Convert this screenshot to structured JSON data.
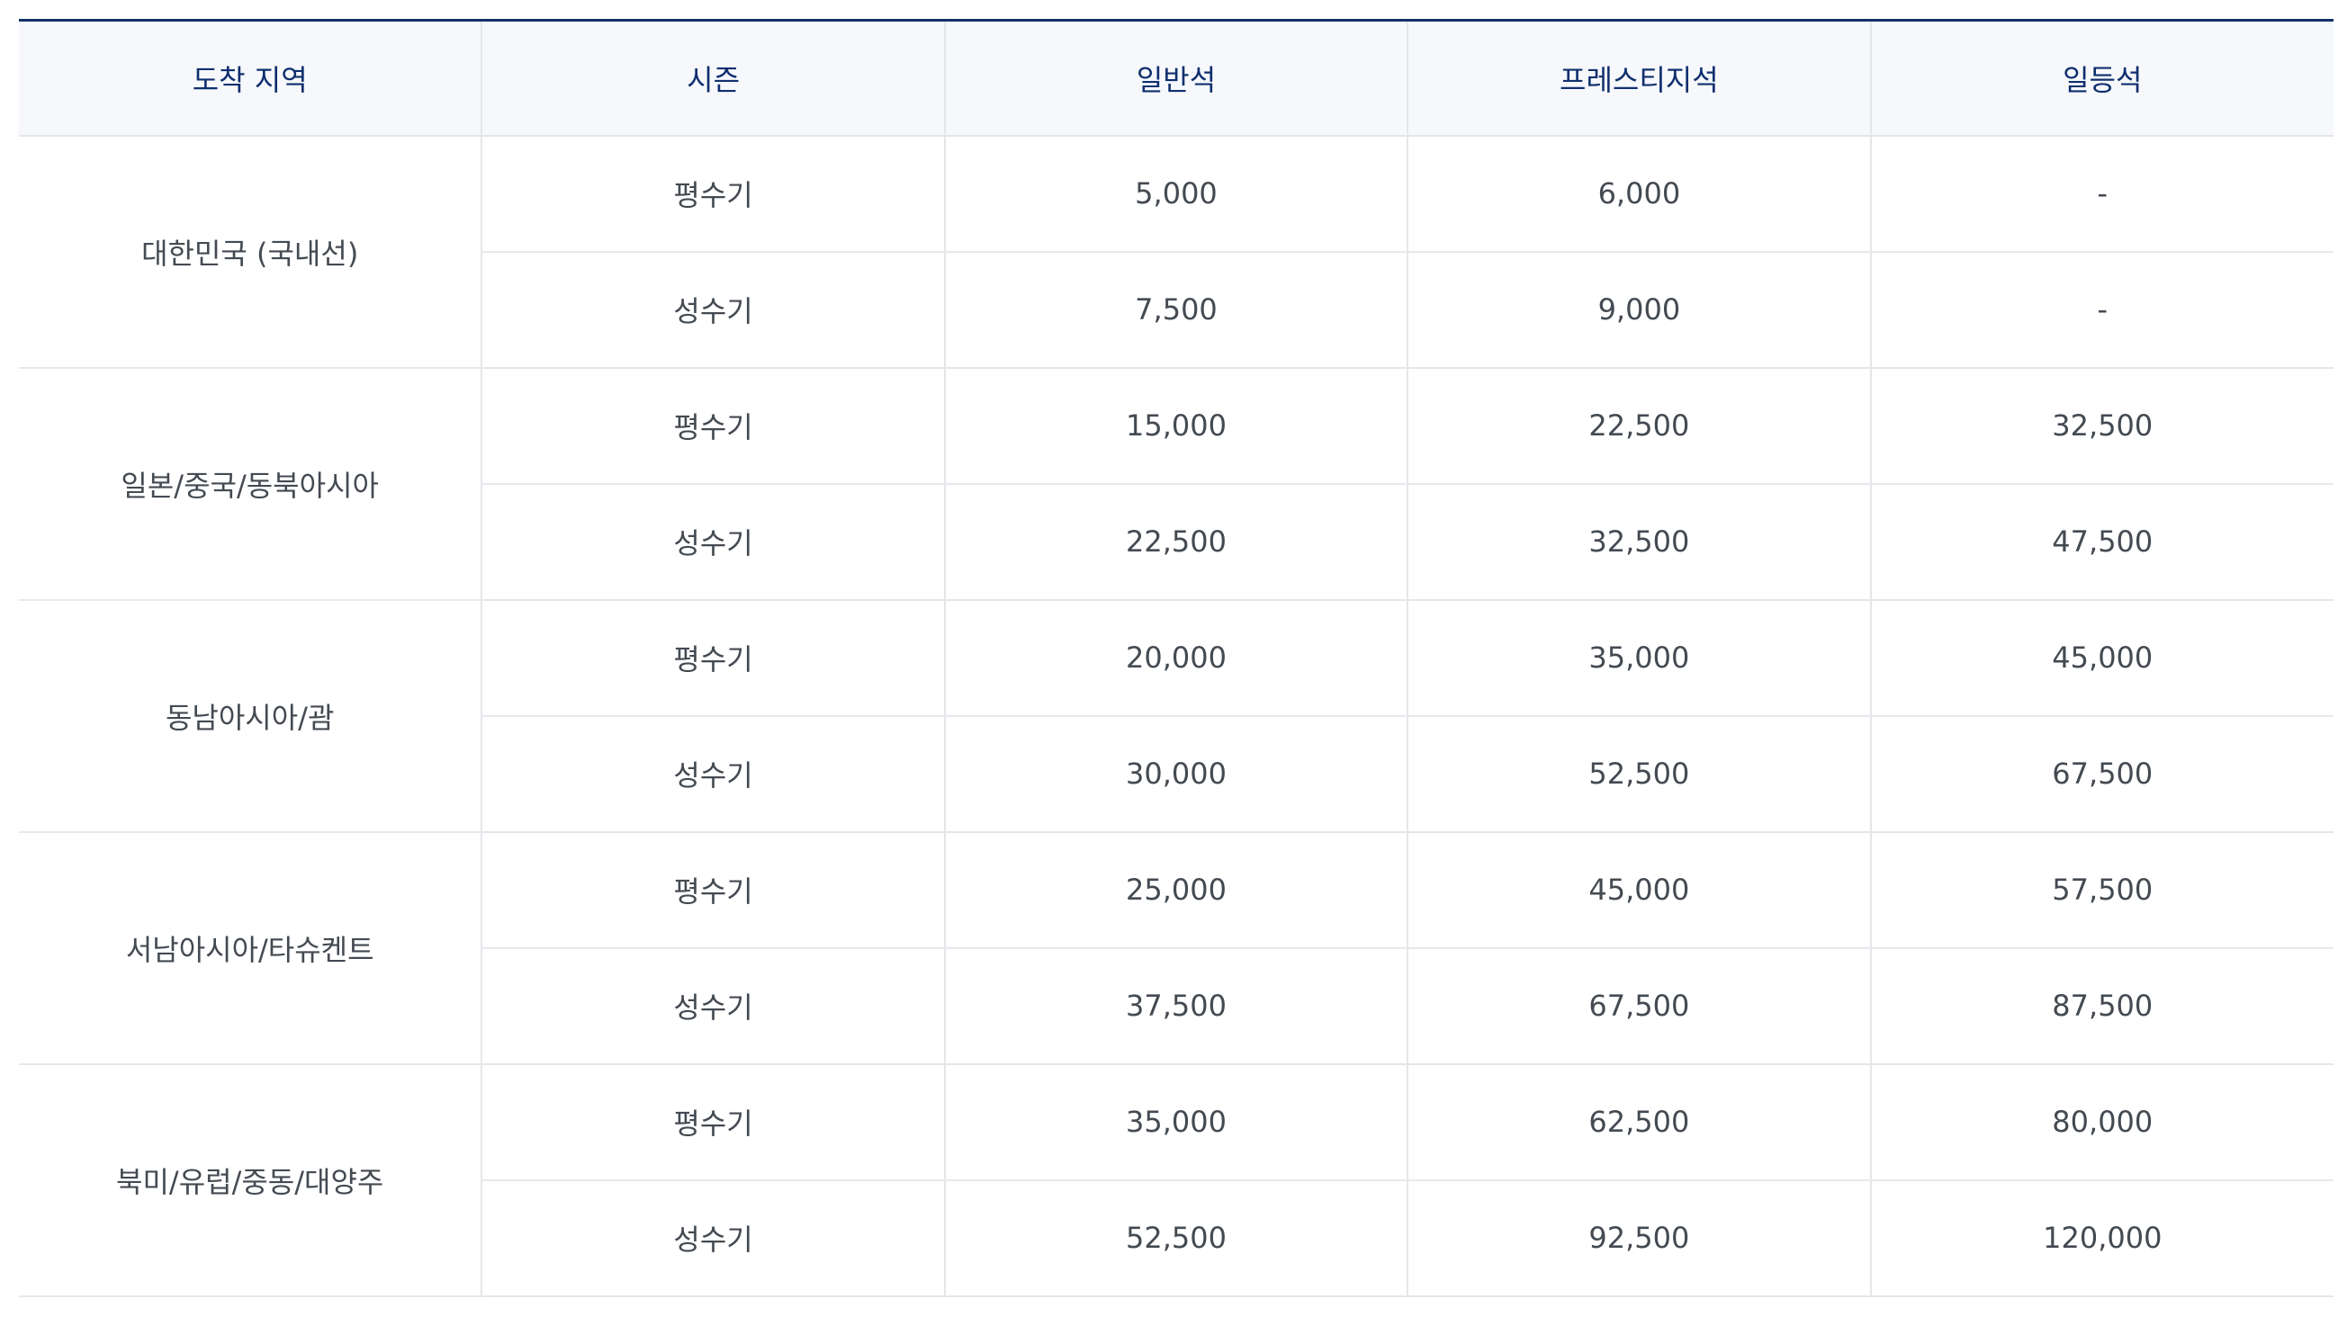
{
  "table": {
    "headers": [
      "도착 지역",
      "시즌",
      "일반석",
      "프레스티지석",
      "일등석"
    ],
    "groups": [
      {
        "region": "대한민국 (국내선)",
        "rows": [
          {
            "season": "평수기",
            "economy": "5,000",
            "prestige": "6,000",
            "first": "-"
          },
          {
            "season": "성수기",
            "economy": "7,500",
            "prestige": "9,000",
            "first": "-"
          }
        ]
      },
      {
        "region": "일본/중국/동북아시아",
        "rows": [
          {
            "season": "평수기",
            "economy": "15,000",
            "prestige": "22,500",
            "first": "32,500"
          },
          {
            "season": "성수기",
            "economy": "22,500",
            "prestige": "32,500",
            "first": "47,500"
          }
        ]
      },
      {
        "region": "동남아시아/괌",
        "rows": [
          {
            "season": "평수기",
            "economy": "20,000",
            "prestige": "35,000",
            "first": "45,000"
          },
          {
            "season": "성수기",
            "economy": "30,000",
            "prestige": "52,500",
            "first": "67,500"
          }
        ]
      },
      {
        "region": "서남아시아/타슈켄트",
        "rows": [
          {
            "season": "평수기",
            "economy": "25,000",
            "prestige": "45,000",
            "first": "57,500"
          },
          {
            "season": "성수기",
            "economy": "37,500",
            "prestige": "67,500",
            "first": "87,500"
          }
        ]
      },
      {
        "region": "북미/유럽/중동/대양주",
        "rows": [
          {
            "season": "평수기",
            "economy": "35,000",
            "prestige": "62,500",
            "first": "80,000"
          },
          {
            "season": "성수기",
            "economy": "52,500",
            "prestige": "92,500",
            "first": "120,000"
          }
        ]
      }
    ]
  },
  "colors": {
    "header_text": "#0f2f6e",
    "header_bg": "#f6f8fb",
    "top_border": "#12306b",
    "grid": "#e4e6ea",
    "body_text": "#444a52"
  }
}
